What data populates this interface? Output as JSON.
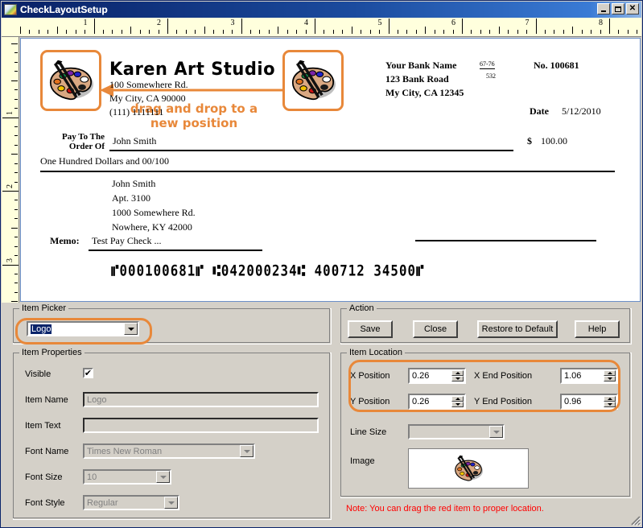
{
  "window": {
    "title": "CheckLayoutSetup",
    "icon": "app-icon",
    "buttons": {
      "minimize": "_",
      "maximize": "□",
      "close": "✕"
    }
  },
  "rulers": {
    "horizontal": [
      "1",
      "2",
      "3",
      "4",
      "5",
      "6",
      "7",
      "8"
    ],
    "vertical": [
      "1",
      "2",
      "3"
    ]
  },
  "check": {
    "business_name": "Karen Art Studio",
    "address_line1": "100 Somewhere Rd.",
    "address_line2": "My City, CA 90000",
    "phone": "(111) 1111111",
    "bank_name": "Your Bank Name",
    "bank_address": "123 Bank Road",
    "bank_city": "My City, CA 12345",
    "fraction_top": "67-76",
    "fraction_bottom": "532",
    "check_number": "No. 100681",
    "date_label": "Date",
    "date_value": "5/12/2010",
    "pay_to_label_line1": "Pay To The",
    "pay_to_label_line2": "Order Of",
    "payee": "John Smith",
    "dollar_symbol": "$",
    "amount": "100.00",
    "amount_words": "One Hundred  Dollars and 00/100",
    "addr_name": "John Smith",
    "addr_apt": "Apt. 3100",
    "addr_street": "1000 Somewhere Rd.",
    "addr_citystate": "Nowhere, KY 42000",
    "memo_label": "Memo:",
    "memo_value": "Test Pay Check ...",
    "micr_line": "⑈000100681⑈ ⑆042000234⑆ 400712 34500⑈",
    "drag_hint_line1": "drag and drop to a",
    "drag_hint_line2": "new position"
  },
  "item_picker": {
    "legend": "Item Picker",
    "selected": "Logo"
  },
  "item_properties": {
    "legend": "Item Properties",
    "visible_label": "Visible",
    "visible_checked": "✔",
    "item_name_label": "Item Name",
    "item_name_value": "Logo",
    "item_text_label": "Item Text",
    "item_text_value": "",
    "font_name_label": "Font Name",
    "font_name_value": "Times New Roman",
    "font_size_label": "Font Size",
    "font_size_value": "10",
    "font_style_label": "Font Style",
    "font_style_value": "Regular"
  },
  "action": {
    "legend": "Action",
    "save": "Save",
    "close": "Close",
    "restore": "Restore to Default",
    "help": "Help"
  },
  "item_location": {
    "legend": "Item Location",
    "x_position_label": "X Position",
    "x_position_value": "0.26",
    "x_end_label": "X End Position",
    "x_end_value": "1.06",
    "y_position_label": "Y Position",
    "y_position_value": "0.26",
    "y_end_label": "Y End Position",
    "y_end_value": "0.96",
    "line_size_label": "Line Size",
    "line_size_value": "",
    "image_label": "Image"
  },
  "note": "Note: You can drag the red item to proper location.",
  "colors": {
    "titlebar": "#0a246a",
    "face": "#d4d0c8",
    "ruler": "#ffffdd",
    "highlight": "#e8883a",
    "note": "#ff0000"
  }
}
